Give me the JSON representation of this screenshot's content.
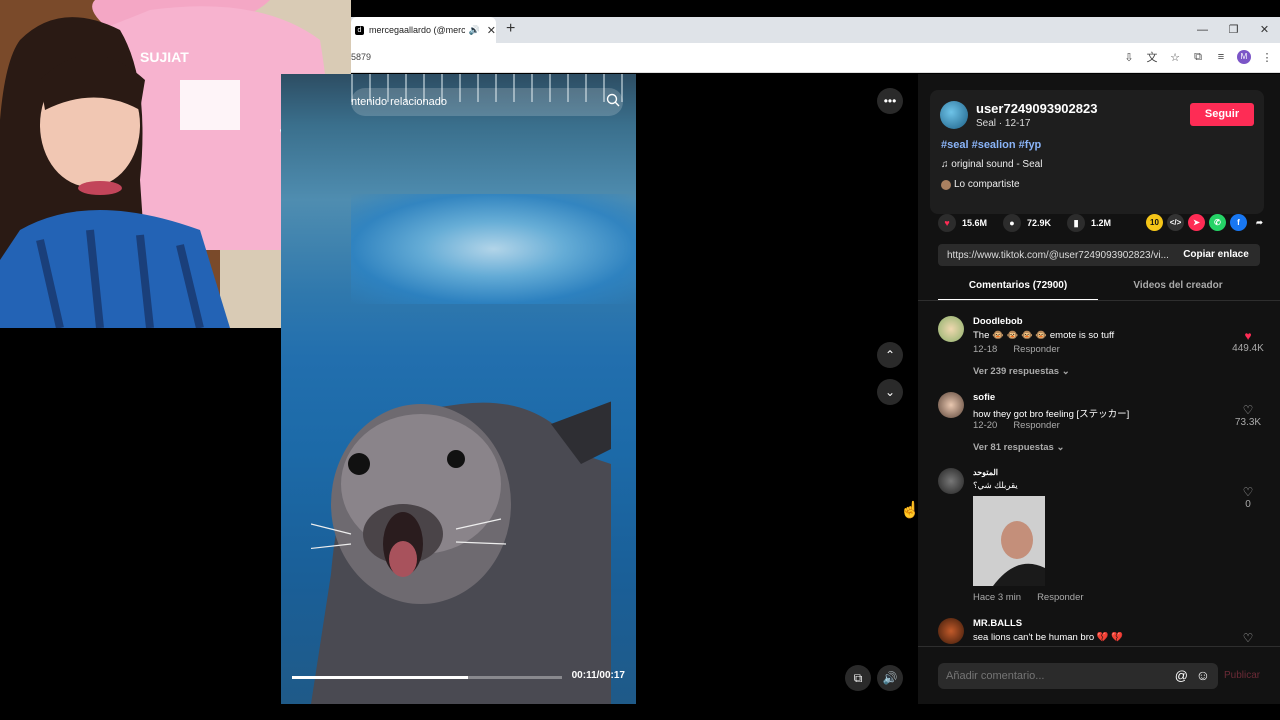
{
  "browser": {
    "tab_title": "mercegaallardo (@mercega",
    "url_fragment": "5879",
    "profile_initial": "M"
  },
  "video": {
    "search_placeholder": "ntenido relacionado",
    "time": "00:11/00:17",
    "progress": 0.65
  },
  "post": {
    "author": "user7249093902823",
    "sub": "Seal · 12-17",
    "follow_label": "Seguir",
    "hashtags": "#seal #sealion #fyp",
    "sound": "original sound - Seal",
    "shared": "Lo compartiste",
    "likes": "15.6M",
    "comments": "72.9K",
    "saves": "1.2M",
    "link": "https://www.tiktok.com/@user7249093902823/vi...",
    "copy_label": "Copiar enlace"
  },
  "tabs": {
    "comments": "Comentarios (72900)",
    "creator": "Videos del creador"
  },
  "comments": [
    {
      "user": "Doodlebob",
      "text": "The 🐵 🐵 🐵 🐵 emote is so tuff",
      "date": "12-18",
      "reply": "Responder",
      "replies": "Ver 239 respuestas ⌄",
      "likes": "449.4K"
    },
    {
      "user": "sofie",
      "text": "how they got bro feeling [ステッカー]",
      "date": "12-20",
      "reply": "Responder",
      "replies": "Ver 81 respuestas ⌄",
      "likes": "73.3K"
    },
    {
      "user": "المتوحد",
      "text": "يقربلك شي؟",
      "date": "Hace 3 min",
      "reply": "Responder",
      "likes": "0"
    },
    {
      "user": "MR.BALLS",
      "text": "sea lions can't be human bro 💔 💔"
    }
  ],
  "composer": {
    "placeholder": "Añadir comentario...",
    "publish": "Publicar"
  },
  "colors": {
    "accent": "#fe2c55",
    "panel": "#121212",
    "hashtag": "#8ab4f8"
  }
}
